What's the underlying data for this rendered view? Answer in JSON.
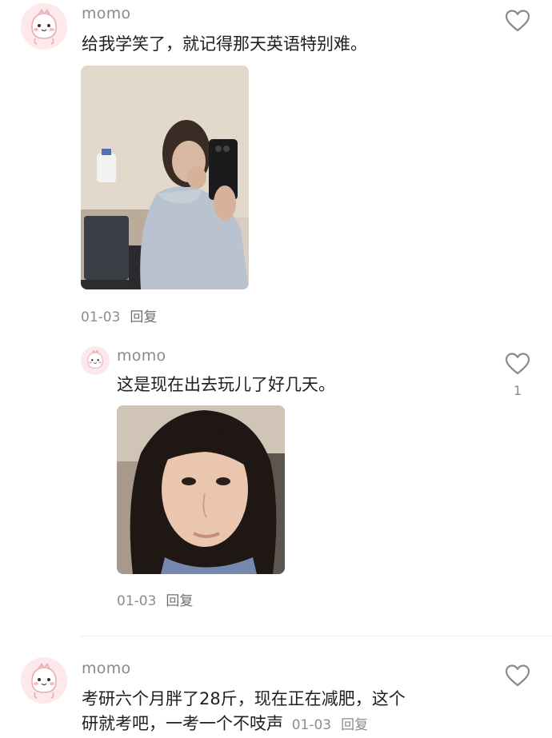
{
  "comments": [
    {
      "username": "momo",
      "text": "给我学笑了，就记得那天英语特别难。",
      "date": "01-03",
      "reply_label": "回复",
      "photo_icon": "mirror-selfie-photo"
    },
    {
      "username": "momo",
      "text": "这是现在出去玩儿了好几天。",
      "date": "01-03",
      "reply_label": "回复",
      "like_count": "1",
      "photo_icon": "face-selfie-photo"
    },
    {
      "username": "momo",
      "text_line1": "考研六个月胖了28斤，现在正在减肥，这个",
      "text_line2": "研就考吧，一考一个不吱声",
      "date": "01-03",
      "reply_label": "回复"
    }
  ],
  "colors": {
    "username": "#8a8a8a",
    "meta": "#8c8c8c",
    "heart_stroke": "#8a8a8a",
    "avatar_bg": "#fde6ea"
  }
}
